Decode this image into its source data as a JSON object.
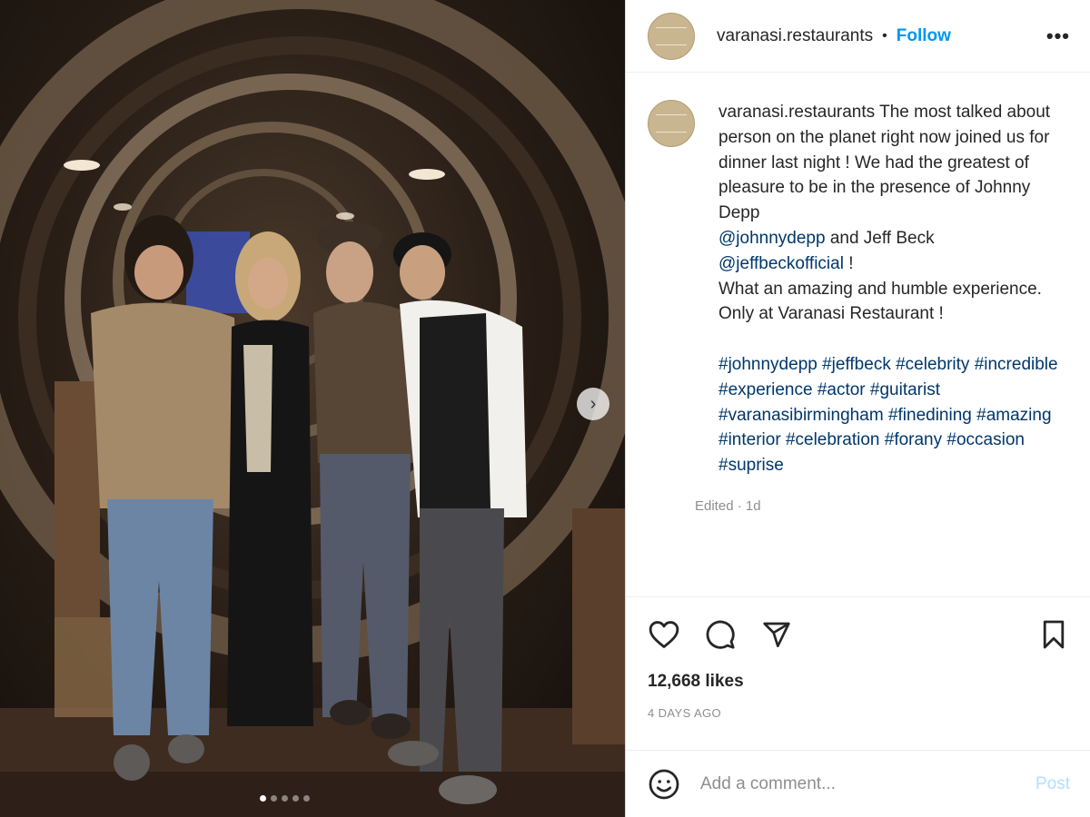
{
  "header": {
    "username": "varanasi.restaurants",
    "separator": "•",
    "follow_label": "Follow",
    "more_label": "•••"
  },
  "caption": {
    "username": "varanasi.restaurants",
    "text_1": "The most talked about person on the planet right now joined us for dinner last night ! We had the greatest of pleasure to be in the presence of Johnny Depp",
    "mention_1": "@johnnydepp",
    "text_2": "and Jeff Beck",
    "mention_2": "@jeffbeckofficial",
    "text_3": "!",
    "text_4": "What an amazing and humble experience. Only at Varanasi Restaurant !",
    "hashtags": [
      "#johnnydepp",
      "#jeffbeck",
      "#celebrity",
      "#incredible",
      "#experience",
      "#actor",
      "#guitarist",
      "#varanasibirmingham",
      "#finedining",
      "#amazing",
      "#interior",
      "#celebration",
      "#forany",
      "#occasion",
      "#suprise"
    ],
    "edited": "Edited · 1d"
  },
  "actions": {
    "like_icon": "heart-icon",
    "comment_icon": "comment-icon",
    "share_icon": "paper-plane-icon",
    "save_icon": "bookmark-icon"
  },
  "likes": "12,668 likes",
  "time_ago": "4 DAYS AGO",
  "comment": {
    "placeholder": "Add a comment...",
    "post_label": "Post",
    "emoji_icon": "smiley-icon"
  },
  "media": {
    "next_icon": "chevron-right-icon",
    "carousel_count": 5,
    "carousel_active": 1
  },
  "colors": {
    "link": "#0095f6",
    "hashtag": "#00376b",
    "muted": "#8e8e8e"
  }
}
